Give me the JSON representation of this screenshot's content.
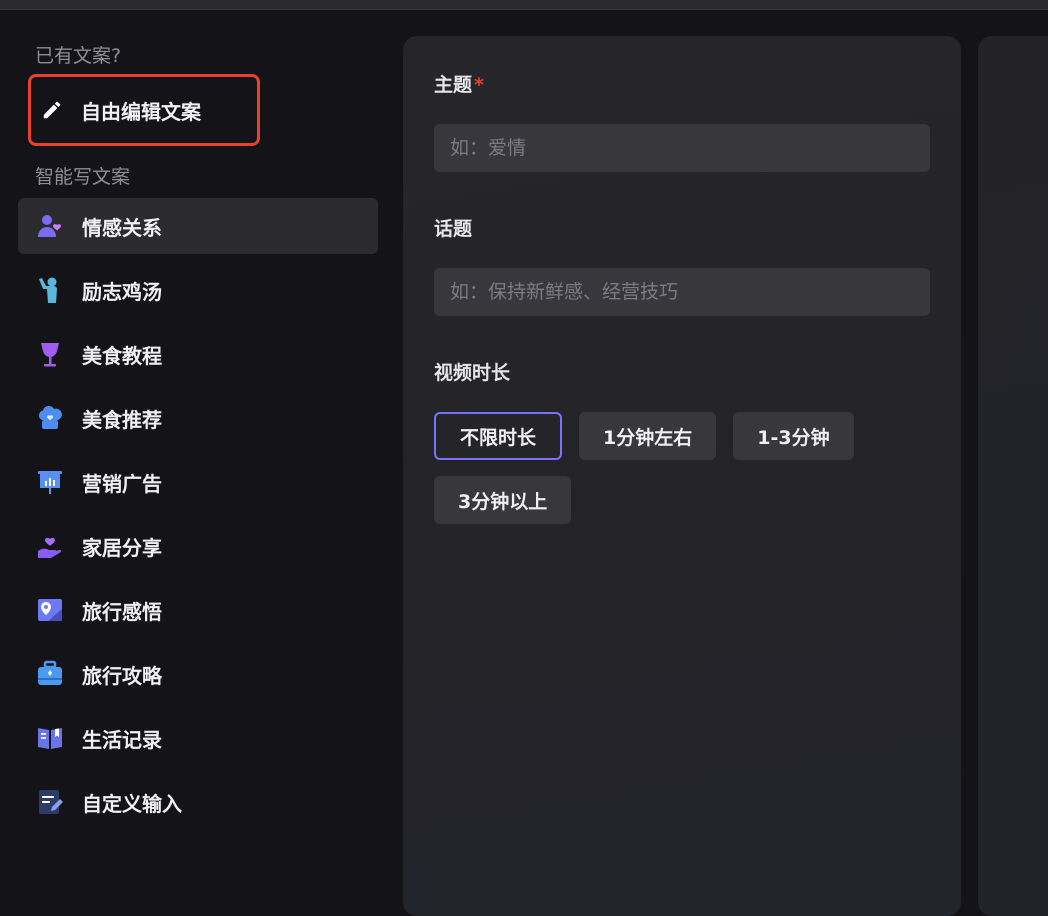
{
  "sidebar": {
    "has_copy_label": "已有文案?",
    "free_edit_label": "自由编辑文案",
    "smart_write_label": "智能写文案",
    "items": [
      {
        "label": "情感关系",
        "icon": "users-heart-icon",
        "color": "#7b6cf6"
      },
      {
        "label": "励志鸡汤",
        "icon": "person-cheer-icon",
        "color": "#5bb7d9"
      },
      {
        "label": "美食教程",
        "icon": "wine-glass-icon",
        "color": "#a15cf0"
      },
      {
        "label": "美食推荐",
        "icon": "chef-hat-icon",
        "color": "#4e8df0"
      },
      {
        "label": "营销广告",
        "icon": "presentation-board-icon",
        "color": "#5a8ff2"
      },
      {
        "label": "家居分享",
        "icon": "hand-heart-icon",
        "color": "#8a5cf6"
      },
      {
        "label": "旅行感悟",
        "icon": "map-pin-icon",
        "color": "#6e78f5"
      },
      {
        "label": "旅行攻略",
        "icon": "suitcase-icon",
        "color": "#4a9af0"
      },
      {
        "label": "生活记录",
        "icon": "open-book-icon",
        "color": "#6a74e8"
      },
      {
        "label": "自定义输入",
        "icon": "edit-note-icon",
        "color": "#5a6aa8"
      }
    ]
  },
  "form": {
    "topic_label": "主题",
    "required_mark": "*",
    "topic_placeholder": "如：爱情",
    "subject_label": "话题",
    "subject_placeholder": "如：保持新鲜感、经营技巧",
    "duration_label": "视频时长",
    "duration_options": [
      "不限时长",
      "1分钟左右",
      "1-3分钟",
      "3分钟以上"
    ],
    "selected_duration": "不限时长"
  },
  "colors": {
    "accent_border": "#7a72ff",
    "highlight_red": "#e8412d"
  }
}
